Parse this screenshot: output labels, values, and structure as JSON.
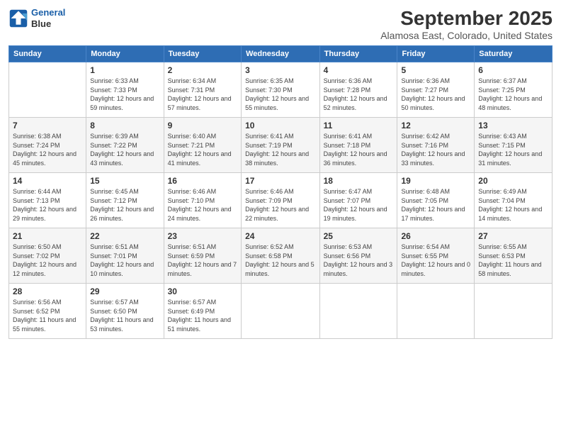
{
  "logo": {
    "line1": "General",
    "line2": "Blue"
  },
  "title": "September 2025",
  "location": "Alamosa East, Colorado, United States",
  "days_header": [
    "Sunday",
    "Monday",
    "Tuesday",
    "Wednesday",
    "Thursday",
    "Friday",
    "Saturday"
  ],
  "weeks": [
    [
      {
        "day": "",
        "sunrise": "",
        "sunset": "",
        "daylight": ""
      },
      {
        "day": "1",
        "sunrise": "Sunrise: 6:33 AM",
        "sunset": "Sunset: 7:33 PM",
        "daylight": "Daylight: 12 hours and 59 minutes."
      },
      {
        "day": "2",
        "sunrise": "Sunrise: 6:34 AM",
        "sunset": "Sunset: 7:31 PM",
        "daylight": "Daylight: 12 hours and 57 minutes."
      },
      {
        "day": "3",
        "sunrise": "Sunrise: 6:35 AM",
        "sunset": "Sunset: 7:30 PM",
        "daylight": "Daylight: 12 hours and 55 minutes."
      },
      {
        "day": "4",
        "sunrise": "Sunrise: 6:36 AM",
        "sunset": "Sunset: 7:28 PM",
        "daylight": "Daylight: 12 hours and 52 minutes."
      },
      {
        "day": "5",
        "sunrise": "Sunrise: 6:36 AM",
        "sunset": "Sunset: 7:27 PM",
        "daylight": "Daylight: 12 hours and 50 minutes."
      },
      {
        "day": "6",
        "sunrise": "Sunrise: 6:37 AM",
        "sunset": "Sunset: 7:25 PM",
        "daylight": "Daylight: 12 hours and 48 minutes."
      }
    ],
    [
      {
        "day": "7",
        "sunrise": "Sunrise: 6:38 AM",
        "sunset": "Sunset: 7:24 PM",
        "daylight": "Daylight: 12 hours and 45 minutes."
      },
      {
        "day": "8",
        "sunrise": "Sunrise: 6:39 AM",
        "sunset": "Sunset: 7:22 PM",
        "daylight": "Daylight: 12 hours and 43 minutes."
      },
      {
        "day": "9",
        "sunrise": "Sunrise: 6:40 AM",
        "sunset": "Sunset: 7:21 PM",
        "daylight": "Daylight: 12 hours and 41 minutes."
      },
      {
        "day": "10",
        "sunrise": "Sunrise: 6:41 AM",
        "sunset": "Sunset: 7:19 PM",
        "daylight": "Daylight: 12 hours and 38 minutes."
      },
      {
        "day": "11",
        "sunrise": "Sunrise: 6:41 AM",
        "sunset": "Sunset: 7:18 PM",
        "daylight": "Daylight: 12 hours and 36 minutes."
      },
      {
        "day": "12",
        "sunrise": "Sunrise: 6:42 AM",
        "sunset": "Sunset: 7:16 PM",
        "daylight": "Daylight: 12 hours and 33 minutes."
      },
      {
        "day": "13",
        "sunrise": "Sunrise: 6:43 AM",
        "sunset": "Sunset: 7:15 PM",
        "daylight": "Daylight: 12 hours and 31 minutes."
      }
    ],
    [
      {
        "day": "14",
        "sunrise": "Sunrise: 6:44 AM",
        "sunset": "Sunset: 7:13 PM",
        "daylight": "Daylight: 12 hours and 29 minutes."
      },
      {
        "day": "15",
        "sunrise": "Sunrise: 6:45 AM",
        "sunset": "Sunset: 7:12 PM",
        "daylight": "Daylight: 12 hours and 26 minutes."
      },
      {
        "day": "16",
        "sunrise": "Sunrise: 6:46 AM",
        "sunset": "Sunset: 7:10 PM",
        "daylight": "Daylight: 12 hours and 24 minutes."
      },
      {
        "day": "17",
        "sunrise": "Sunrise: 6:46 AM",
        "sunset": "Sunset: 7:09 PM",
        "daylight": "Daylight: 12 hours and 22 minutes."
      },
      {
        "day": "18",
        "sunrise": "Sunrise: 6:47 AM",
        "sunset": "Sunset: 7:07 PM",
        "daylight": "Daylight: 12 hours and 19 minutes."
      },
      {
        "day": "19",
        "sunrise": "Sunrise: 6:48 AM",
        "sunset": "Sunset: 7:05 PM",
        "daylight": "Daylight: 12 hours and 17 minutes."
      },
      {
        "day": "20",
        "sunrise": "Sunrise: 6:49 AM",
        "sunset": "Sunset: 7:04 PM",
        "daylight": "Daylight: 12 hours and 14 minutes."
      }
    ],
    [
      {
        "day": "21",
        "sunrise": "Sunrise: 6:50 AM",
        "sunset": "Sunset: 7:02 PM",
        "daylight": "Daylight: 12 hours and 12 minutes."
      },
      {
        "day": "22",
        "sunrise": "Sunrise: 6:51 AM",
        "sunset": "Sunset: 7:01 PM",
        "daylight": "Daylight: 12 hours and 10 minutes."
      },
      {
        "day": "23",
        "sunrise": "Sunrise: 6:51 AM",
        "sunset": "Sunset: 6:59 PM",
        "daylight": "Daylight: 12 hours and 7 minutes."
      },
      {
        "day": "24",
        "sunrise": "Sunrise: 6:52 AM",
        "sunset": "Sunset: 6:58 PM",
        "daylight": "Daylight: 12 hours and 5 minutes."
      },
      {
        "day": "25",
        "sunrise": "Sunrise: 6:53 AM",
        "sunset": "Sunset: 6:56 PM",
        "daylight": "Daylight: 12 hours and 3 minutes."
      },
      {
        "day": "26",
        "sunrise": "Sunrise: 6:54 AM",
        "sunset": "Sunset: 6:55 PM",
        "daylight": "Daylight: 12 hours and 0 minutes."
      },
      {
        "day": "27",
        "sunrise": "Sunrise: 6:55 AM",
        "sunset": "Sunset: 6:53 PM",
        "daylight": "Daylight: 11 hours and 58 minutes."
      }
    ],
    [
      {
        "day": "28",
        "sunrise": "Sunrise: 6:56 AM",
        "sunset": "Sunset: 6:52 PM",
        "daylight": "Daylight: 11 hours and 55 minutes."
      },
      {
        "day": "29",
        "sunrise": "Sunrise: 6:57 AM",
        "sunset": "Sunset: 6:50 PM",
        "daylight": "Daylight: 11 hours and 53 minutes."
      },
      {
        "day": "30",
        "sunrise": "Sunrise: 6:57 AM",
        "sunset": "Sunset: 6:49 PM",
        "daylight": "Daylight: 11 hours and 51 minutes."
      },
      {
        "day": "",
        "sunrise": "",
        "sunset": "",
        "daylight": ""
      },
      {
        "day": "",
        "sunrise": "",
        "sunset": "",
        "daylight": ""
      },
      {
        "day": "",
        "sunrise": "",
        "sunset": "",
        "daylight": ""
      },
      {
        "day": "",
        "sunrise": "",
        "sunset": "",
        "daylight": ""
      }
    ]
  ]
}
